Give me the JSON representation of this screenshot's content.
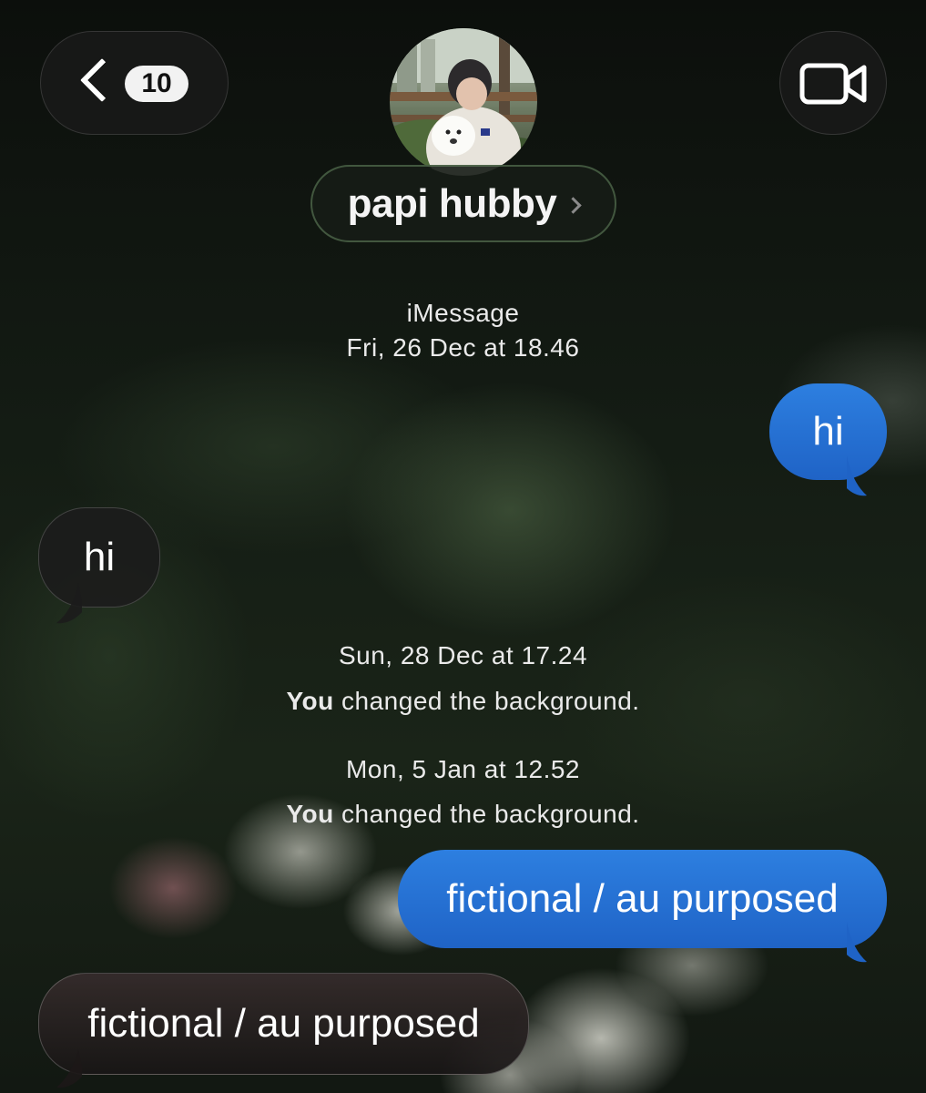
{
  "header": {
    "back_label": "Back",
    "unread_count": "10",
    "contact_name": "papi hubby",
    "video_icon": "video-camera-icon",
    "back_icon": "chevron-left-icon"
  },
  "thread": {
    "service": "iMessage",
    "timestamp_1": "Fri, 26 Dec at 18.46",
    "timestamp_2": "Sun, 28 Dec at 17.24",
    "event_2_actor": "You",
    "event_2_text": " changed the background.",
    "timestamp_3": "Mon, 5 Jan at 12.52",
    "event_3_actor": "You",
    "event_3_text": " changed the background."
  },
  "messages": [
    {
      "direction": "sent",
      "text": "hi"
    },
    {
      "direction": "received",
      "text": "hi"
    },
    {
      "direction": "sent",
      "text": "fictional / au purposed"
    },
    {
      "direction": "received",
      "text": "fictional / au purposed"
    }
  ],
  "colors": {
    "sent_bubble": "#2070d6",
    "received_bubble": "#1c1c1c",
    "badge_bg": "#f2f2f2"
  }
}
